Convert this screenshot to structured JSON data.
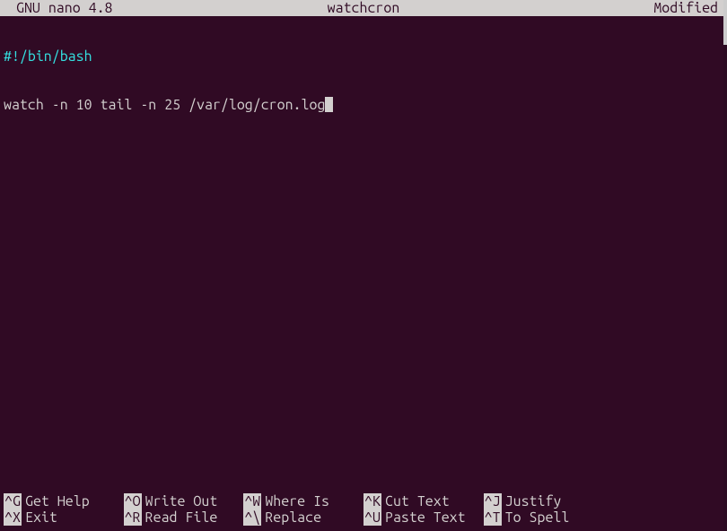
{
  "header": {
    "app": "GNU nano 4.8",
    "filename": "watchcron",
    "status": "Modified"
  },
  "content": {
    "line1": "#!/bin/bash",
    "line2": "watch -n 10 tail -n 25 /var/log/cron.log"
  },
  "shortcuts": [
    {
      "key": "^G",
      "label": "Get Help"
    },
    {
      "key": "^O",
      "label": "Write Out"
    },
    {
      "key": "^W",
      "label": "Where Is"
    },
    {
      "key": "^K",
      "label": "Cut Text"
    },
    {
      "key": "^J",
      "label": "Justify"
    },
    {
      "key": "^X",
      "label": "Exit"
    },
    {
      "key": "^R",
      "label": "Read File"
    },
    {
      "key": "^\\",
      "label": "Replace"
    },
    {
      "key": "^U",
      "label": "Paste Text"
    },
    {
      "key": "^T",
      "label": "To Spell"
    }
  ]
}
